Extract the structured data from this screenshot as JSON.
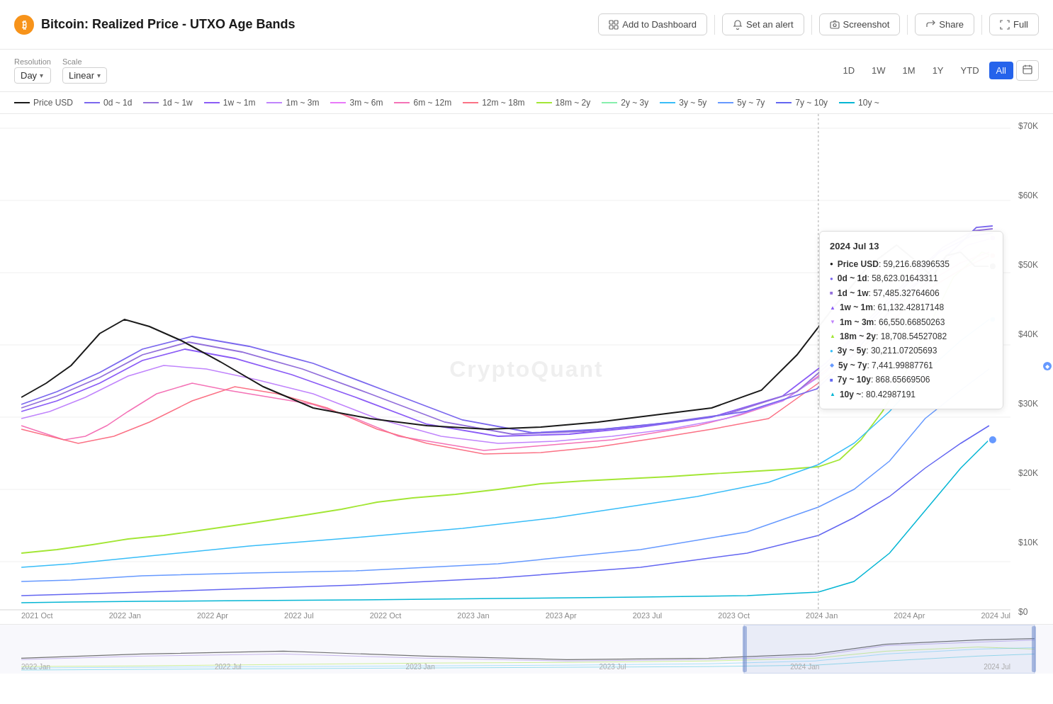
{
  "header": {
    "title": "Bitcoin: Realized Price - UTXO Age Bands",
    "bitcoin_symbol": "₿",
    "buttons": [
      {
        "label": "Add to Dashboard",
        "icon": "dashboard-icon",
        "name": "add-to-dashboard-button"
      },
      {
        "label": "Set an alert",
        "icon": "bell-icon",
        "name": "set-alert-button"
      },
      {
        "label": "Screenshot",
        "icon": "camera-icon",
        "name": "screenshot-button"
      },
      {
        "label": "Share",
        "icon": "share-icon",
        "name": "share-button"
      },
      {
        "label": "Full",
        "icon": "fullscreen-icon",
        "name": "fullscreen-button"
      }
    ]
  },
  "toolbar": {
    "resolution_label": "Resolution",
    "resolution_value": "Day",
    "scale_label": "Scale",
    "scale_value": "Linear",
    "time_buttons": [
      "1D",
      "1W",
      "1M",
      "1Y",
      "YTD",
      "All"
    ],
    "active_time": "All"
  },
  "legend": {
    "items": [
      {
        "label": "Price USD",
        "color": "#1a1a1a",
        "style": "solid"
      },
      {
        "label": "0d ~ 1d",
        "color": "#7b68ee",
        "style": "solid"
      },
      {
        "label": "1d ~ 1w",
        "color": "#9370db",
        "style": "solid"
      },
      {
        "label": "1w ~ 1m",
        "color": "#8b5cf6",
        "style": "solid"
      },
      {
        "label": "1m ~ 3m",
        "color": "#c084fc",
        "style": "solid"
      },
      {
        "label": "3m ~ 6m",
        "color": "#e879f9",
        "style": "solid"
      },
      {
        "label": "6m ~ 12m",
        "color": "#f472b6",
        "style": "solid"
      },
      {
        "label": "12m ~ 18m",
        "color": "#fb7185",
        "style": "solid"
      },
      {
        "label": "18m ~ 2y",
        "color": "#a3e635",
        "style": "solid"
      },
      {
        "label": "2y ~ 3y",
        "color": "#86efac",
        "style": "solid"
      },
      {
        "label": "3y ~ 5y",
        "color": "#38bdf8",
        "style": "solid"
      },
      {
        "label": "5y ~ 7y",
        "color": "#60a5fa",
        "style": "solid"
      },
      {
        "label": "7y ~ 10y",
        "color": "#6366f1",
        "style": "solid"
      },
      {
        "label": "10y ~",
        "color": "#06b6d4",
        "style": "solid"
      }
    ]
  },
  "tooltip": {
    "date": "2024 Jul 13",
    "rows": [
      {
        "symbol": "circle",
        "color": "#1a1a1a",
        "label": "Price USD:",
        "value": "59,216.68396535"
      },
      {
        "symbol": "circle",
        "color": "#7b68ee",
        "label": "0d ~ 1d:",
        "value": "58,623.01643311"
      },
      {
        "symbol": "square",
        "color": "#9370db",
        "label": "1d ~ 1w:",
        "value": "57,485.32764606"
      },
      {
        "symbol": "triangle-up",
        "color": "#8b5cf6",
        "label": "1w ~ 1m:",
        "value": "61,132.42817148"
      },
      {
        "symbol": "triangle-down",
        "color": "#c084fc",
        "label": "1m ~ 3m:",
        "value": "66,550.66850263"
      },
      {
        "symbol": "triangle-up",
        "color": "#a3e635",
        "label": "18m ~ 2y:",
        "value": "18,708.54527082"
      },
      {
        "symbol": "circle",
        "color": "#38bdf8",
        "label": "3y ~ 5y:",
        "value": "30,211.07205693"
      },
      {
        "symbol": "diamond",
        "color": "#60a5fa",
        "label": "5y ~ 7y:",
        "value": "7,441.99887761"
      },
      {
        "symbol": "square",
        "color": "#6366f1",
        "label": "7y ~ 10y:",
        "value": "868.65669506"
      },
      {
        "symbol": "triangle-up",
        "color": "#06b6d4",
        "label": "10y ~:",
        "value": "80.42987191"
      }
    ]
  },
  "y_axis": {
    "labels": [
      "$70K",
      "$60K",
      "$50K",
      "$40K",
      "$30K",
      "$20K",
      "$10K",
      "$0"
    ]
  },
  "x_axis": {
    "labels": [
      "2021 Oct",
      "2022 Jan",
      "2022 Apr",
      "2022 Jul",
      "2022 Oct",
      "2023 Jan",
      "2023 Apr",
      "2023 Jul",
      "2023 Oct",
      "2024 Jan",
      "2024 Apr",
      "2024 Jul"
    ]
  },
  "minimap": {
    "labels": [
      "2022 Jan",
      "2022 Jul",
      "2023Jan",
      "2023 Jul",
      "2024 Jan",
      "2024 Jul"
    ]
  },
  "watermark": "CryptoQuant"
}
